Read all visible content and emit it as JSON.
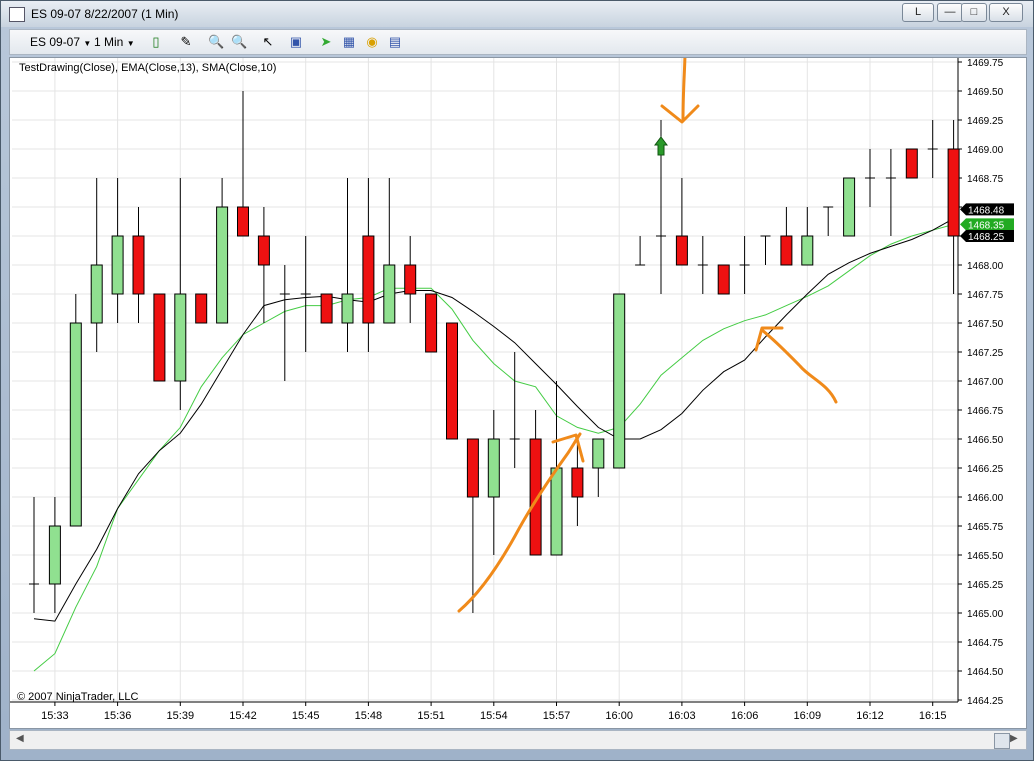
{
  "window": {
    "title": "ES 09-07  8/22/2007  (1 Min)",
    "buttons": [
      "L",
      "",
      "",
      "X"
    ]
  },
  "toolbar": {
    "instrument": "ES 09-07",
    "interval": "1 Min",
    "icons": [
      "candlestick-icon",
      "pencil-icon",
      "zoom-in-icon",
      "zoom-out-icon",
      "cursor-icon",
      "properties-icon",
      "strategy-icon",
      "chart-style-icon",
      "coin-icon",
      "data-box-icon"
    ]
  },
  "chart": {
    "indicator_label": "TestDrawing(Close), EMA(Close,13), SMA(Close,10)",
    "copyright": "© 2007 NinjaTrader, LLC",
    "up_color": "#90e090",
    "down_color": "#ee1111",
    "ema_color": "#000000",
    "sma_color": "#44cc44",
    "annotation_color": "#f08a1a"
  },
  "chart_data": {
    "type": "candlestick",
    "y_ticks": [
      "1469.75",
      "1469.50",
      "1469.25",
      "1469.00",
      "1468.75",
      "1468.50",
      "1468.25",
      "1468.00",
      "1467.75",
      "1467.50",
      "1467.25",
      "1467.00",
      "1466.75",
      "1466.50",
      "1466.25",
      "1466.00",
      "1465.75",
      "1465.50",
      "1465.25",
      "1465.00",
      "1464.75",
      "1464.50",
      "1464.25"
    ],
    "ylim": [
      1464.25,
      1469.75
    ],
    "x_ticks": [
      "15:33",
      "15:36",
      "15:39",
      "15:42",
      "15:45",
      "15:48",
      "15:51",
      "15:54",
      "15:57",
      "16:00",
      "16:03",
      "16:06",
      "16:09",
      "16:12",
      "16:15"
    ],
    "price_labels": [
      {
        "text": "1468.48",
        "value": 1468.48,
        "color": "#000000"
      },
      {
        "text": "1468.35",
        "value": 1468.35,
        "color": "#22aa22"
      },
      {
        "text": "1468.25",
        "value": 1468.25,
        "color": "#000000"
      }
    ],
    "candles": [
      {
        "o": 1465.25,
        "h": 1466.0,
        "l": 1465.0,
        "c": 1465.25
      },
      {
        "o": 1465.25,
        "h": 1466.0,
        "l": 1465.0,
        "c": 1465.75
      },
      {
        "o": 1465.75,
        "h": 1467.75,
        "l": 1465.75,
        "c": 1467.5
      },
      {
        "o": 1467.5,
        "h": 1468.75,
        "l": 1467.25,
        "c": 1468.0
      },
      {
        "o": 1467.75,
        "h": 1468.75,
        "l": 1467.5,
        "c": 1468.25
      },
      {
        "o": 1468.25,
        "h": 1468.5,
        "l": 1467.5,
        "c": 1467.75
      },
      {
        "o": 1467.75,
        "h": 1467.75,
        "l": 1467.0,
        "c": 1467.0
      },
      {
        "o": 1467.0,
        "h": 1468.75,
        "l": 1466.75,
        "c": 1467.75
      },
      {
        "o": 1467.75,
        "h": 1467.75,
        "l": 1467.5,
        "c": 1467.5
      },
      {
        "o": 1467.5,
        "h": 1468.75,
        "l": 1467.5,
        "c": 1468.5
      },
      {
        "o": 1468.5,
        "h": 1469.5,
        "l": 1468.25,
        "c": 1468.25
      },
      {
        "o": 1468.25,
        "h": 1468.5,
        "l": 1467.5,
        "c": 1468.0
      },
      {
        "o": 1467.75,
        "h": 1468.0,
        "l": 1467.0,
        "c": 1467.75
      },
      {
        "o": 1467.75,
        "h": 1468.25,
        "l": 1467.25,
        "c": 1467.75
      },
      {
        "o": 1467.75,
        "h": 1467.75,
        "l": 1467.5,
        "c": 1467.5
      },
      {
        "o": 1467.5,
        "h": 1468.75,
        "l": 1467.25,
        "c": 1467.75
      },
      {
        "o": 1468.25,
        "h": 1468.75,
        "l": 1467.25,
        "c": 1467.5
      },
      {
        "o": 1467.5,
        "h": 1468.75,
        "l": 1467.5,
        "c": 1468.0
      },
      {
        "o": 1468.0,
        "h": 1468.25,
        "l": 1467.5,
        "c": 1467.75
      },
      {
        "o": 1467.75,
        "h": 1467.75,
        "l": 1467.25,
        "c": 1467.25
      },
      {
        "o": 1467.5,
        "h": 1467.5,
        "l": 1466.5,
        "c": 1466.5
      },
      {
        "o": 1466.5,
        "h": 1466.5,
        "l": 1465.0,
        "c": 1466.0
      },
      {
        "o": 1466.0,
        "h": 1466.75,
        "l": 1465.5,
        "c": 1466.5
      },
      {
        "o": 1466.5,
        "h": 1467.25,
        "l": 1466.25,
        "c": 1466.5
      },
      {
        "o": 1466.5,
        "h": 1466.75,
        "l": 1465.5,
        "c": 1465.5
      },
      {
        "o": 1465.5,
        "h": 1467.0,
        "l": 1465.5,
        "c": 1466.25
      },
      {
        "o": 1466.25,
        "h": 1466.5,
        "l": 1465.75,
        "c": 1466.0
      },
      {
        "o": 1466.25,
        "h": 1466.5,
        "l": 1466.0,
        "c": 1466.5
      },
      {
        "o": 1466.25,
        "h": 1467.75,
        "l": 1466.25,
        "c": 1467.75
      },
      {
        "o": 1468.0,
        "h": 1468.25,
        "l": 1468.0,
        "c": 1468.0
      },
      {
        "o": 1468.25,
        "h": 1469.25,
        "l": 1467.75,
        "c": 1468.25
      },
      {
        "o": 1468.25,
        "h": 1468.75,
        "l": 1468.0,
        "c": 1468.0
      },
      {
        "o": 1468.0,
        "h": 1468.25,
        "l": 1467.75,
        "c": 1468.0
      },
      {
        "o": 1468.0,
        "h": 1468.0,
        "l": 1467.75,
        "c": 1467.75
      },
      {
        "o": 1468.0,
        "h": 1468.25,
        "l": 1467.75,
        "c": 1468.0
      },
      {
        "o": 1468.25,
        "h": 1468.25,
        "l": 1468.0,
        "c": 1468.25
      },
      {
        "o": 1468.25,
        "h": 1468.5,
        "l": 1468.0,
        "c": 1468.0
      },
      {
        "o": 1468.0,
        "h": 1468.5,
        "l": 1468.0,
        "c": 1468.25
      },
      {
        "o": 1468.5,
        "h": 1468.5,
        "l": 1468.25,
        "c": 1468.5
      },
      {
        "o": 1468.25,
        "h": 1468.75,
        "l": 1468.25,
        "c": 1468.75
      },
      {
        "o": 1468.75,
        "h": 1469.0,
        "l": 1468.5,
        "c": 1468.75
      },
      {
        "o": 1468.75,
        "h": 1469.0,
        "l": 1468.25,
        "c": 1468.75
      },
      {
        "o": 1469.0,
        "h": 1469.0,
        "l": 1468.75,
        "c": 1468.75
      },
      {
        "o": 1469.0,
        "h": 1469.25,
        "l": 1468.75,
        "c": 1469.0
      },
      {
        "o": 1469.0,
        "h": 1469.25,
        "l": 1467.75,
        "c": 1468.25
      }
    ],
    "ema_values": [
      1464.95,
      1464.93,
      1465.25,
      1465.55,
      1465.9,
      1466.2,
      1466.4,
      1466.55,
      1466.8,
      1467.1,
      1467.4,
      1467.65,
      1467.7,
      1467.72,
      1467.73,
      1467.7,
      1467.68,
      1467.75,
      1467.78,
      1467.78,
      1467.72,
      1467.6,
      1467.47,
      1467.33,
      1467.15,
      1466.97,
      1466.78,
      1466.6,
      1466.5,
      1466.5,
      1466.58,
      1466.72,
      1466.92,
      1467.08,
      1467.18,
      1467.38,
      1467.57,
      1467.75,
      1467.92,
      1468.02,
      1468.1,
      1468.16,
      1468.22,
      1468.3,
      1468.4
    ],
    "sma_values": [
      1464.5,
      1464.65,
      1465.05,
      1465.4,
      1465.9,
      1466.15,
      1466.4,
      1466.6,
      1466.95,
      1467.2,
      1467.4,
      1467.5,
      1467.6,
      1467.65,
      1467.65,
      1467.7,
      1467.72,
      1467.8,
      1467.8,
      1467.8,
      1467.62,
      1467.35,
      1467.15,
      1467.0,
      1466.95,
      1466.7,
      1466.6,
      1466.55,
      1466.6,
      1466.8,
      1467.05,
      1467.2,
      1467.35,
      1467.45,
      1467.52,
      1467.57,
      1467.65,
      1467.73,
      1467.82,
      1467.95,
      1468.08,
      1468.18,
      1468.25,
      1468.3,
      1468.35
    ],
    "signal_arrow": {
      "index": 30,
      "value": 1469.0
    }
  }
}
